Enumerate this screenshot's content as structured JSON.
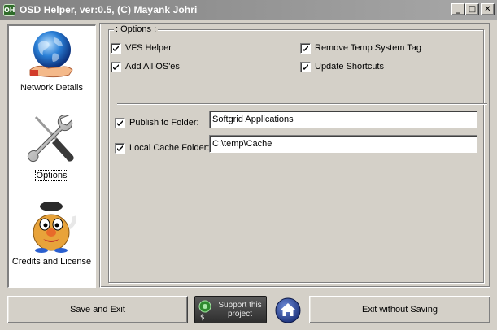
{
  "window": {
    "title": "OSD Helper, ver:0.5, (C) Mayank Johri",
    "app_icon_text": "OH",
    "controls": {
      "minimize": "_",
      "maximize": "□",
      "close": "✕"
    }
  },
  "sidebar": {
    "items": [
      {
        "label": "Network Details",
        "icon": "globe-hand-icon",
        "selected": false
      },
      {
        "label": "Options",
        "icon": "wrench-screwdriver-icon",
        "selected": true
      },
      {
        "label": "Credits and License",
        "icon": "potato-head-icon",
        "selected": false
      }
    ]
  },
  "options": {
    "legend": ": Options :",
    "checkboxes": [
      {
        "label": "VFS Helper",
        "checked": true
      },
      {
        "label": "Remove Temp System Tag",
        "checked": true
      },
      {
        "label": "Add All OS'es",
        "checked": true
      },
      {
        "label": "Update Shortcuts",
        "checked": true
      }
    ],
    "publish": {
      "label": "Publish to Folder:",
      "checked": true,
      "value": "Softgrid Applications"
    },
    "cache": {
      "label": "Local Cache Folder:",
      "checked": true,
      "value": "C:\\temp\\Cache"
    }
  },
  "footer": {
    "save_label": "Save and Exit",
    "support_label": "Support this project",
    "exit_label": "Exit without Saving",
    "home_icon": "home-icon",
    "support_icon": "donate-icon"
  },
  "colors": {
    "face": "#d4d0c8",
    "title_gradient_start": "#808080",
    "title_gradient_end": "#a8a8a8",
    "selected_text": "#000080"
  }
}
